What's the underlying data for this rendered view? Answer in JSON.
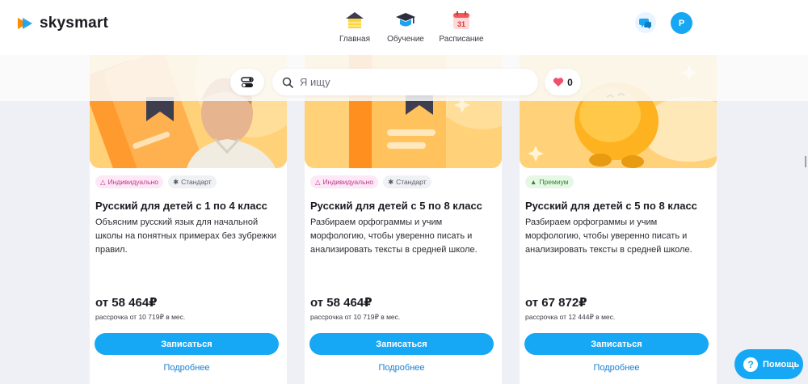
{
  "brand": {
    "name": "skysmart"
  },
  "nav": [
    {
      "label": "Главная",
      "icon": "home-icon"
    },
    {
      "label": "Обучение",
      "icon": "graduation-cap-icon"
    },
    {
      "label": "Расписание",
      "icon": "calendar-icon",
      "calendar_day": "31"
    }
  ],
  "header": {
    "chat_icon": "chat-icon",
    "avatar_letter": "P"
  },
  "search": {
    "placeholder": "Я ищу",
    "value": ""
  },
  "favorites": {
    "count": "0",
    "icon": "heart-icon"
  },
  "cards": [
    {
      "badges": [
        {
          "label": "Индивидуально",
          "type": "individual",
          "icon": "hat-icon"
        },
        {
          "label": "Стандарт",
          "type": "standard",
          "icon": "gear-icon"
        }
      ],
      "title": "Русский для детей с 1 по 4 класс",
      "description": "Объясним русский язык для начальной школы на понятных примерах без зубрежки правил.",
      "price": "от 58 464₽",
      "installment": "рассрочка от 10 719₽ в мес.",
      "enroll_label": "Записаться",
      "more_label": "Подробнее"
    },
    {
      "badges": [
        {
          "label": "Индивидуально",
          "type": "individual",
          "icon": "hat-icon"
        },
        {
          "label": "Стандарт",
          "type": "standard",
          "icon": "gear-icon"
        }
      ],
      "title": "Русский для детей с 5 по 8 класс",
      "description": "Разбираем орфограммы и учим морфологию, чтобы уверенно писать и анализировать тексты в средней школе.",
      "price": "от 58 464₽",
      "installment": "рассрочка от 10 719₽ в мес.",
      "enroll_label": "Записаться",
      "more_label": "Подробнее"
    },
    {
      "badges": [
        {
          "label": "Премиум",
          "type": "premium",
          "icon": "thumbs-up-icon"
        }
      ],
      "title": "Русский для детей с 5 по 8 класс",
      "description": "Разбираем орфограммы и учим морфологию, чтобы уверенно писать и анализировать тексты в средней школе.",
      "price": "от 67 872₽",
      "installment": "рассрочка от 12 444₽ в мес.",
      "enroll_label": "Записаться",
      "more_label": "Подробнее"
    }
  ],
  "help": {
    "label": "Помощь",
    "icon_glyph": "?"
  },
  "colors": {
    "accent": "#17a8f5",
    "card_art": "#ffd27a",
    "badge_individual": "#c0358f",
    "badge_premium": "#2a8a2e"
  }
}
